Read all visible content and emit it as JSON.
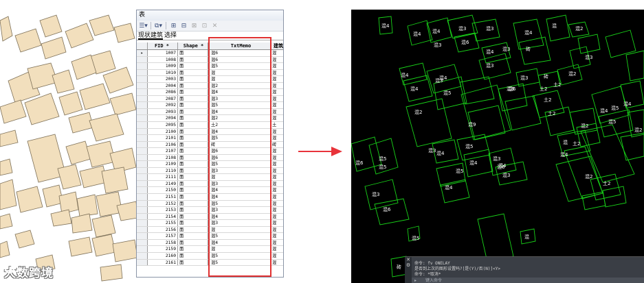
{
  "watermark": {
    "text": "大数跨境"
  },
  "table": {
    "window_title": "表",
    "tabs": [
      "现状建筑",
      "选择"
    ],
    "headers": {
      "fid": "FID *",
      "shape": "Shape *",
      "memo": "TxtMemo",
      "extra": "建筑"
    },
    "rows": [
      {
        "fid": "1007",
        "shape": "面",
        "memo": "混6",
        "extra": "混"
      },
      {
        "fid": "1008",
        "shape": "面",
        "memo": "混6",
        "extra": "混"
      },
      {
        "fid": "1009",
        "shape": "面",
        "memo": "混5",
        "extra": "混"
      },
      {
        "fid": "1010",
        "shape": "面",
        "memo": "混",
        "extra": "混"
      },
      {
        "fid": "2003",
        "shape": "面",
        "memo": "混",
        "extra": "混"
      },
      {
        "fid": "2004",
        "shape": "面",
        "memo": "混2",
        "extra": "混"
      },
      {
        "fid": "2086",
        "shape": "面",
        "memo": "混4",
        "extra": "混"
      },
      {
        "fid": "2087",
        "shape": "面",
        "memo": "混3",
        "extra": "混"
      },
      {
        "fid": "2092",
        "shape": "面",
        "memo": "混5",
        "extra": "混"
      },
      {
        "fid": "2093",
        "shape": "面",
        "memo": "混4",
        "extra": "混"
      },
      {
        "fid": "2094",
        "shape": "面",
        "memo": "混2",
        "extra": "混"
      },
      {
        "fid": "2095",
        "shape": "面",
        "memo": "土2",
        "extra": "土"
      },
      {
        "fid": "2100",
        "shape": "面",
        "memo": "混4",
        "extra": "混"
      },
      {
        "fid": "2101",
        "shape": "面",
        "memo": "混5",
        "extra": "混"
      },
      {
        "fid": "2106",
        "shape": "面",
        "memo": "砖",
        "extra": "砖"
      },
      {
        "fid": "2107",
        "shape": "面",
        "memo": "混6",
        "extra": "混"
      },
      {
        "fid": "2108",
        "shape": "面",
        "memo": "混6",
        "extra": "混"
      },
      {
        "fid": "2109",
        "shape": "面",
        "memo": "混5",
        "extra": "混"
      },
      {
        "fid": "2110",
        "shape": "面",
        "memo": "混3",
        "extra": "混"
      },
      {
        "fid": "2111",
        "shape": "面",
        "memo": "混",
        "extra": "混"
      },
      {
        "fid": "2149",
        "shape": "面",
        "memo": "混3",
        "extra": "混"
      },
      {
        "fid": "2150",
        "shape": "面",
        "memo": "混4",
        "extra": "混"
      },
      {
        "fid": "2151",
        "shape": "面",
        "memo": "混4",
        "extra": "混"
      },
      {
        "fid": "2152",
        "shape": "面",
        "memo": "混5",
        "extra": "混"
      },
      {
        "fid": "2153",
        "shape": "面",
        "memo": "混3",
        "extra": "混"
      },
      {
        "fid": "2154",
        "shape": "面",
        "memo": "混4",
        "extra": "混"
      },
      {
        "fid": "2155",
        "shape": "面",
        "memo": "混3",
        "extra": "混"
      },
      {
        "fid": "2156",
        "shape": "面",
        "memo": "混",
        "extra": "混"
      },
      {
        "fid": "2157",
        "shape": "面",
        "memo": "混5",
        "extra": "混"
      },
      {
        "fid": "2158",
        "shape": "面",
        "memo": "混4",
        "extra": "混"
      },
      {
        "fid": "2159",
        "shape": "面",
        "memo": "混",
        "extra": "混"
      },
      {
        "fid": "2160",
        "shape": "面",
        "memo": "混5",
        "extra": "混"
      },
      {
        "fid": "2161",
        "shape": "面",
        "memo": "混5",
        "extra": "混"
      }
    ],
    "selected_marker": "▸"
  },
  "cad": {
    "labels": [
      "混4",
      "混4",
      "混4",
      "混3",
      "混3",
      "混3",
      "混4",
      "混6",
      "混4",
      "混",
      "混2",
      "砖",
      "混3",
      "混3",
      "混4",
      "混4",
      "混3",
      "混4",
      "混3",
      "混5",
      "混6",
      "混3",
      "混2",
      "砖",
      "土2",
      "土2",
      "混2",
      "混5",
      "混9",
      "混6",
      "土2",
      "土2",
      "混4",
      "混5",
      "混2",
      "混4",
      "混2",
      "混",
      "混3",
      "土2",
      "混6",
      "混5",
      "混5",
      "混4",
      "混5",
      "混4",
      "混3",
      "混6",
      "混4",
      "混3",
      "土2",
      "混2",
      "混5",
      "混4",
      "混3",
      "混6",
      "混5",
      "混",
      "砖",
      "混4"
    ],
    "command_history": [
      "命令: fv ONELAY",
      "是否到上次的图形设置吗?[是(Y)/否(N)]<Y>",
      "命令: *取消*"
    ],
    "command_prompt": "键入命令"
  },
  "colors": {
    "cad_line": "#19d419",
    "highlight": "#e03030",
    "building_fill": "#f2dfbd"
  }
}
